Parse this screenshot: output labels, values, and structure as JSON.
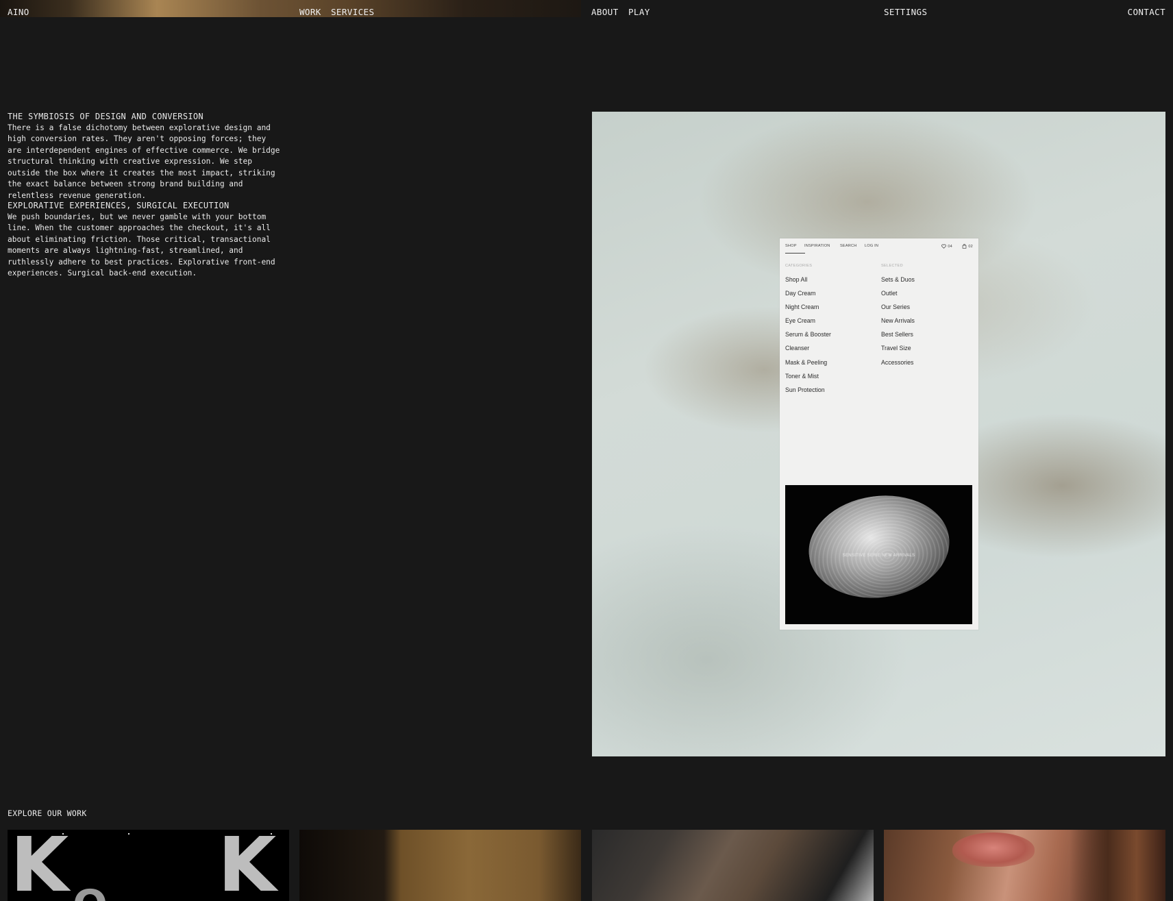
{
  "header": {
    "logo": "AINO",
    "nav_left": [
      "WORK",
      "SERVICES"
    ],
    "nav_right": [
      "ABOUT",
      "PLAY"
    ],
    "settings": "SETTINGS",
    "contact": "CONTACT"
  },
  "intro": [
    {
      "heading": "THE SYMBIOSIS OF DESIGN AND CONVERSION",
      "body": "There is a false dichotomy between explorative design and high conversion rates. They aren't opposing forces; they are interdependent engines of effective commerce. We bridge structural thinking with creative expression. We step outside the box where it creates the most impact, striking the exact balance between strong brand building and relentless revenue generation."
    },
    {
      "heading": "EXPLORATIVE EXPERIENCES, SURGICAL EXECUTION",
      "body": "We push boundaries, but we never gamble with your bottom line. When the customer approaches the checkout, it's all about eliminating friction. Those critical, transactional moments are always lightning-fast, streamlined, and ruthlessly adhere to best practices. Explorative front-end experiences. Surgical back-end execution."
    }
  ],
  "mockup": {
    "nav": [
      "SHOP",
      "INSPIRATION",
      "SEARCH",
      "LOG IN"
    ],
    "wishlist_count": "04",
    "cart_count": "02",
    "categories_heading": "CATEGORIES",
    "categories": [
      "Shop All",
      "Day Cream",
      "Night Cream",
      "Eye Cream",
      "Serum & Booster",
      "Cleanser",
      "Mask & Peeling",
      "Toner & Mist",
      "Sun Protection"
    ],
    "selected_heading": "SELECTED",
    "selected": [
      "Sets & Duos",
      "Outlet",
      "Our Series",
      "New Arrivals",
      "Best Sellers",
      "Travel Size",
      "Accessories"
    ],
    "banner_text": "SENSITIVE SERIE NEW ARRIVALS"
  },
  "work": {
    "title": "EXPLORE OUR WORK",
    "card1_letters": [
      "K",
      "K",
      "O"
    ]
  },
  "colors": {
    "background": "#181818",
    "text": "#e9e9e9",
    "mockup_bg": "#f1f1f0"
  }
}
